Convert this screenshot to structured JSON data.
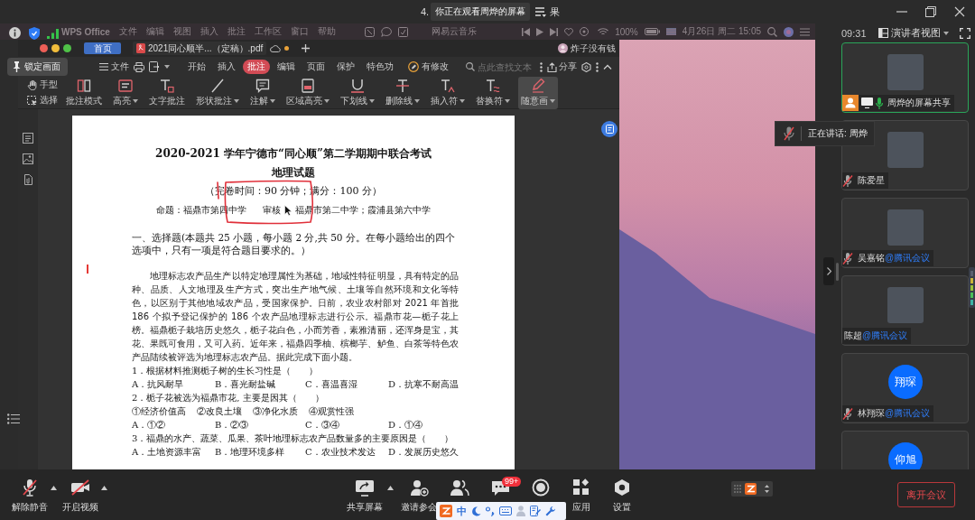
{
  "meeting_bar": {
    "notice_before": "4.",
    "notice": "你正在观看周烨的屏幕",
    "notice_after": "果"
  },
  "screen_overlay": {
    "lock_button": "锁定画面"
  },
  "mac_menu_bar": {
    "app_name": "WPS Office",
    "menus": [
      "文件",
      "编辑",
      "视图",
      "插入",
      "批注",
      "工作区",
      "窗口",
      "帮助"
    ],
    "music_app": "网易云音乐",
    "battery": "100%",
    "datetime": "4月26日 周二 15:05"
  },
  "wps": {
    "home_tab": "首页",
    "document_tab": "2021同心顺半...（定稿）.pdf",
    "user": "炸子没有钱",
    "file_menu": "文件",
    "ribbon_tabs": [
      {
        "label": "开始",
        "selected": false
      },
      {
        "label": "插入",
        "selected": false
      },
      {
        "label": "批注",
        "selected": true
      },
      {
        "label": "编辑",
        "selected": false
      },
      {
        "label": "页面",
        "selected": false
      },
      {
        "label": "保护",
        "selected": false
      },
      {
        "label": "特色功",
        "selected": false
      }
    ],
    "revision": "有修改",
    "search": {
      "placeholder": "点此查找文本"
    },
    "share": "分享",
    "pointer_tools": [
      "手型",
      "选择"
    ],
    "tools": [
      {
        "label": "批注模式",
        "dropdown": false,
        "selected": false
      },
      {
        "label": "高亮",
        "dropdown": true,
        "selected": false
      },
      {
        "label": "文字批注",
        "dropdown": false,
        "selected": false
      },
      {
        "label": "形状批注",
        "dropdown": true,
        "selected": false
      },
      {
        "label": "注解",
        "dropdown": true,
        "selected": false
      },
      {
        "label": "区域高亮",
        "dropdown": true,
        "selected": false
      },
      {
        "label": "下划线",
        "dropdown": true,
        "selected": false
      },
      {
        "label": "删除线",
        "dropdown": true,
        "selected": false
      },
      {
        "label": "插入符",
        "dropdown": true,
        "selected": false
      },
      {
        "label": "替换符",
        "dropdown": true,
        "selected": false
      },
      {
        "label": "随意画",
        "dropdown": true,
        "selected": true
      }
    ]
  },
  "document": {
    "title": "2020-2021 学年宁德市“同心顺”第二学期期中联合考试",
    "subtitle": "地理试题",
    "exam_info": "（完卷时间：90 分钟；满分：100 分）",
    "authors": [
      "命题：福鼎市第四中学",
      "审核",
      "福鼎市第二中学；霞浦县第六中学"
    ],
    "section": "一、选择题(本题共 25 小题，每小题 2 分,共 50 分。在每小题给出的四个选项中，只有一项是符合题目要求的。）",
    "passage": "地理标志农产品生产以特定地理属性为基础，地域性特征明显，具有特定的品种、品质、人文地理及生产方式，突出生产地气候、土壤等自然环境和文化等特色，以区别于其他地域农产品，受国家保护。日前，农业农村部对 2021 年首批 186 个拟予登记保护的 186 个农产品地理标志进行公示。福鼎市花—栀子花上榜。福鼎栀子栽培历史悠久，栀子花白色，小而芳香，素雅清丽，还浑身是宝，其花、果既可食用，又可入药。近年来，福鼎四季柚、槟榔芋、鲈鱼、白茶等特色农产品陆续被评选为地理标志农产品。据此完成下面小题。",
    "questions": [
      {
        "stem": "1．根据材料推测栀子树的生长习性是（　　）",
        "options": [
          "A．抗风耐旱",
          "B．喜光耐盐碱",
          "C．喜温喜湿",
          "D．抗寒不耐高温"
        ]
      },
      {
        "stem": "2．栀子花被选为福鼎市花, 主要是因其（　　）",
        "statements": [
          "①经济价值高",
          "②改良土壤",
          "③净化水质",
          "④观赏性强"
        ],
        "options": [
          "A．①②",
          "B．②③",
          "C．③④",
          "D．①④"
        ]
      },
      {
        "stem": "3．福鼎的水产、蔬菜、瓜果、茶叶地理标志农产品数量多的主要原因是（　　）",
        "options": [
          "A．土地资源丰富",
          "B．地理环境多样",
          "C．农业技术发达",
          "D．发展历史悠久"
        ]
      }
    ]
  },
  "panel_header": {
    "time": "09:31",
    "view_mode": "演讲者视图"
  },
  "speaking_toast": "正在讲话: 周烨",
  "participants": [
    {
      "name": "周烨的屏幕共享",
      "kind": "photo",
      "host": true,
      "sharing": true,
      "muted": false,
      "selected": true
    },
    {
      "name": "陈爱星",
      "kind": "photo",
      "host": false,
      "sharing": false,
      "muted": true,
      "selected": false
    },
    {
      "name": "吴嘉铭",
      "tag": "@腾讯会议",
      "kind": "photo",
      "host": false,
      "sharing": false,
      "muted": true,
      "selected": false
    },
    {
      "name": "陈超",
      "tag": "@腾讯会议",
      "kind": "photo",
      "host": false,
      "sharing": false,
      "selected": false
    },
    {
      "name": "林翔琛",
      "tag": "@腾讯会议",
      "kind": "initials",
      "initials": "翔琛",
      "host": false,
      "sharing": false,
      "muted": true,
      "selected": false
    },
    {
      "kind": "initials",
      "initials": "仰旭",
      "host": false,
      "sharing": false,
      "selected": false
    }
  ],
  "controls_left": [
    {
      "label": "解除静音",
      "menu": true
    },
    {
      "label": "开启视频",
      "menu": true
    }
  ],
  "controls_center": [
    {
      "label": "共享屏幕",
      "menu": true
    },
    {
      "label": "邀请参会",
      "menu": false
    },
    {
      "menu": false
    },
    {
      "badge": "99+",
      "menu": false
    },
    {
      "menu": false
    },
    {
      "label": "应用",
      "menu": false
    },
    {
      "label": "设置",
      "menu": false
    }
  ],
  "ime": {
    "mode": "中"
  },
  "leave_button": "离开会议"
}
